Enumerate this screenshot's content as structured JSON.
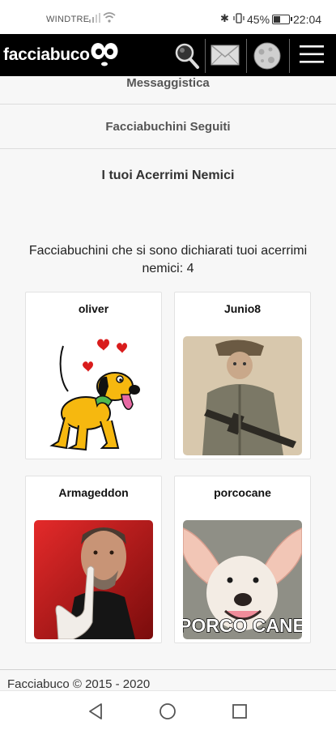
{
  "status_bar": {
    "carrier": "WINDTRE",
    "battery": "45%",
    "time": "22:04"
  },
  "header": {
    "logo": "facciabuco"
  },
  "menu": {
    "item1": "Messaggistica",
    "item2": "Facciabuchini Seguiti"
  },
  "page": {
    "heading": "I tuoi Acerrimi Nemici",
    "count_text": "Facciabuchini che si sono dichiarati tuoi acerrimi nemici: 4"
  },
  "enemies": [
    {
      "name": "oliver"
    },
    {
      "name": "Junio8"
    },
    {
      "name": "Armageddon"
    },
    {
      "name": "porcocane",
      "caption": "PORCO CANE"
    }
  ],
  "footer": {
    "text": "Facciabuco © 2015 - 2020"
  },
  "colors": {
    "appbar": "#000000",
    "page_bg": "#f7f7f7"
  }
}
